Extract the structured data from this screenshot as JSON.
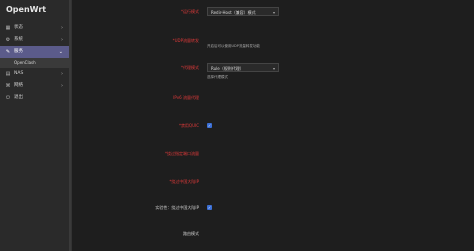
{
  "app": {
    "title": "OpenWrt"
  },
  "sidebar": {
    "items": [
      {
        "label": "状态",
        "icon": "status-icon"
      },
      {
        "label": "系统",
        "icon": "system-icon"
      },
      {
        "label": "服务",
        "icon": "services-icon",
        "active": true
      },
      {
        "label": "NAS",
        "icon": "nas-icon"
      },
      {
        "label": "网络",
        "icon": "network-icon"
      },
      {
        "label": "退出",
        "icon": "logout-icon"
      }
    ],
    "sub_items": [
      {
        "label": "OpenClash"
      }
    ]
  },
  "settings": [
    {
      "label": "*运行模式",
      "value": "Redir-Host（兼容）模式",
      "desc": ""
    },
    {
      "label": "*UDP流量转发",
      "value": "",
      "desc": "开启后可以使用UDP流量转发功能"
    },
    {
      "label": "*代理模式",
      "value": "Rule（规则代理）",
      "desc": "选择代理模式"
    },
    {
      "label": "IPv6 流量代理",
      "value": "",
      "desc": ""
    },
    {
      "label": "*禁用QUIC",
      "value": "",
      "desc": ""
    },
    {
      "label": "*绕过指定端口流量",
      "value": "",
      "desc": ""
    },
    {
      "label": "*绕过中国大陆IP",
      "value": "",
      "desc": ""
    },
    {
      "label": "实验性：绕过中国大陆IP",
      "value": "",
      "desc": ""
    },
    {
      "label": "路由模式",
      "value": "",
      "desc": ""
    }
  ],
  "colors": {
    "accent": "#5b5b8a",
    "required_label": "#e03a3a",
    "checkbox": "#3b6fd6"
  }
}
